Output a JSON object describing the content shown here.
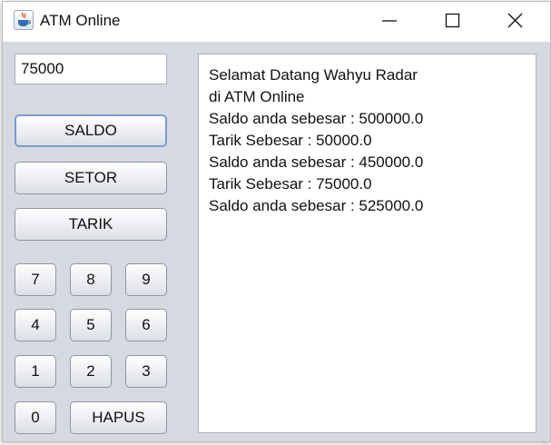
{
  "window": {
    "title": "ATM Online",
    "controls": {
      "minimize": "minimize",
      "maximize": "maximize",
      "close": "close"
    }
  },
  "input": {
    "value": "75000"
  },
  "actions": {
    "saldo": "SALDO",
    "setor": "SETOR",
    "tarik": "TARIK"
  },
  "keypad": {
    "k7": "7",
    "k8": "8",
    "k9": "9",
    "k4": "4",
    "k5": "5",
    "k6": "6",
    "k1": "1",
    "k2": "2",
    "k3": "3",
    "k0": "0",
    "hapus": "HAPUS"
  },
  "output": {
    "lines": [
      "Selamat Datang Wahyu Radar",
      "di ATM Online",
      "Saldo anda sebesar : 500000.0",
      "Tarik Sebesar : 50000.0",
      "Saldo anda sebesar : 450000.0",
      "Tarik Sebesar : 75000.0",
      "Saldo anda sebesar : 525000.0"
    ]
  },
  "icons": {
    "app": "java-coffee-cup-icon",
    "minimize": "minimize-icon",
    "maximize": "maximize-icon",
    "close": "close-icon"
  }
}
